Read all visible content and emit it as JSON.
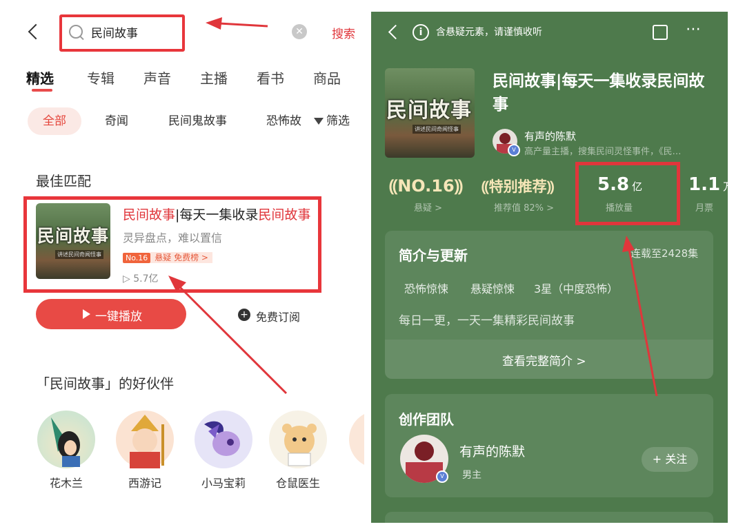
{
  "search": {
    "query": "民间故事",
    "action_label": "搜索"
  },
  "tabs": [
    "精选",
    "专辑",
    "声音",
    "主播",
    "看书",
    "商品"
  ],
  "filters": {
    "chips": [
      "全部",
      "奇闻",
      "民间鬼故事",
      "恐怖故"
    ],
    "filter_label": "筛选"
  },
  "best_match": {
    "section_title": "最佳匹配",
    "title_hl_1": "民间故事",
    "title_mid": "|每天一集收录",
    "title_hl_2": "民间故事",
    "subtitle": "灵异盘点，难以置信",
    "rank_badge": "No.16",
    "rank_category": "悬疑 免费榜 >",
    "play_count": "5.7亿",
    "cover_title": "民间故事",
    "cover_sub": "讲述民间奇闻怪事"
  },
  "actions": {
    "play_all": "一键播放",
    "subscribe": "免费订阅"
  },
  "partners": {
    "section_title": "「民间故事」的好伙伴",
    "items": [
      "花木兰",
      "西游记",
      "小马宝莉",
      "仓鼠医生"
    ]
  },
  "detail": {
    "notice": "含悬疑元素，请谨慎收听",
    "album_title": "民间故事|每天一集收录民间故事",
    "host_name": "有声的陈默",
    "host_desc": "高产量主播，搜集民间灵怪事件，《民…",
    "stats": [
      {
        "value": "NO.16",
        "label": "悬疑 >"
      },
      {
        "value": "特别推荐",
        "label": "推荐值 82% >"
      },
      {
        "value": "5.8",
        "unit": "亿",
        "label": "播放量"
      },
      {
        "value": "1.1",
        "unit": "万",
        "label": "月票"
      }
    ],
    "intro": {
      "title": "简介与更新",
      "episodes": "连载至2428集",
      "tags": [
        "恐怖惊悚",
        "悬疑惊悚",
        "3星（中度恐怖）"
      ],
      "desc": "每日一更，一天一集精彩民间故事",
      "more": "查看完整简介 >"
    },
    "team": {
      "title": "创作团队",
      "member_name": "有声的陈默",
      "member_role": "男主",
      "follow": "+ 关注"
    }
  },
  "colors": {
    "accent_red": "#e0363b",
    "panel_green": "#4e7a4c"
  }
}
